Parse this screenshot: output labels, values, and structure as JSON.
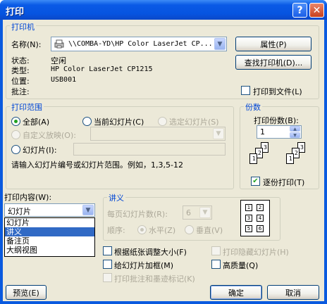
{
  "window": {
    "title": "打印",
    "help_glyph": "?",
    "close_glyph": "✕"
  },
  "printer": {
    "legend": "打印机",
    "name_label": "名称(N):",
    "name_value": "\\\\COMBA-YD\\HP Color LaserJet CP...",
    "status_label": "状态:",
    "status_value": "空闲",
    "type_label": "类型:",
    "type_value": "HP Color LaserJet CP1215",
    "location_label": "位置:",
    "location_value": "USB001",
    "comment_label": "批注:",
    "comment_value": "",
    "properties_button": "属性(P)",
    "find_printer_button": "查找打印机(D)...",
    "print_to_file_label": "打印到文件(L)",
    "print_to_file_checked": false
  },
  "range": {
    "legend": "打印范围",
    "all_label": "全部(A)",
    "current_slide_label": "当前幻灯片(C)",
    "selection_label": "选定幻灯片(S)",
    "custom_show_label": "自定义放映(O):",
    "custom_show_value": "",
    "slides_label": "幻灯片(I):",
    "slides_value": "",
    "hint": "请输入幻灯片编号或幻灯片范围。例如，1,3,5-12",
    "selected": "all"
  },
  "copies": {
    "legend": "份数",
    "count_label": "打印份数(B):",
    "count_value": "1",
    "collate_label": "逐份打印(T)",
    "collate_checked": true,
    "collate_pages": [
      "1",
      "2",
      "3"
    ]
  },
  "print_what": {
    "label": "打印内容(W):",
    "value": "幻灯片",
    "options": [
      "幻灯片",
      "讲义",
      "备注页",
      "大纲视图"
    ],
    "highlighted_index": 1
  },
  "handouts": {
    "legend": "讲义",
    "per_page_label": "每页幻灯片数(R):",
    "per_page_value": "6",
    "order_label": "顺序:",
    "horizontal_label": "水平(Z)",
    "vertical_label": "垂直(V)",
    "preview_cells": [
      "1",
      "2",
      "3",
      "4",
      "5",
      "6"
    ]
  },
  "options": {
    "scale_to_fit": "根据纸张调整大小(F)",
    "frame_slides": "给幻灯片加框(M)",
    "print_comments": "打印批注和墨迹标记(K)",
    "print_hidden": "打印隐藏幻灯片(H)",
    "high_quality": "高质量(Q)"
  },
  "buttons": {
    "preview": "预览(E)",
    "ok": "确定",
    "cancel": "取消"
  },
  "colors": {
    "accent": "#0046d5",
    "title_bar": "#0a5adf",
    "face": "#ece9d8",
    "selection": "#316ac5"
  }
}
